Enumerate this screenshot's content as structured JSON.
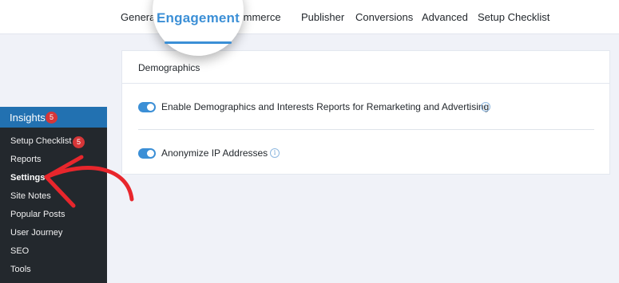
{
  "top_nav": {
    "tabs": [
      "General",
      "Engagement",
      "eCommerce",
      "Publisher",
      "Conversions",
      "Advanced",
      "Setup Checklist"
    ],
    "visible_partial": {
      "general": "General",
      "ecommerce": "Commerce"
    },
    "active_tab": "Engagement"
  },
  "sidebar": {
    "header": {
      "label": "Insights",
      "badge": "5"
    },
    "items": [
      {
        "label": "Setup Checklist",
        "badge": "5"
      },
      {
        "label": "Reports"
      },
      {
        "label": "Settings",
        "active": true
      },
      {
        "label": "Site Notes"
      },
      {
        "label": "Popular Posts"
      },
      {
        "label": "User Journey"
      },
      {
        "label": "SEO"
      },
      {
        "label": "Tools"
      }
    ]
  },
  "card": {
    "title": "Demographics",
    "settings": [
      {
        "label": "Enable Demographics and Interests Reports for Remarketing and Advertising",
        "enabled": true,
        "info_icon": "info-icon"
      },
      {
        "label": "Anonymize IP Addresses",
        "enabled": true,
        "info_icon": "info-icon"
      }
    ]
  },
  "colors": {
    "accent": "#3b8fd6",
    "sidebar_bg": "#23282d",
    "sidebar_header": "#2271b1",
    "badge": "#d63638",
    "arrow": "#e8262c"
  }
}
